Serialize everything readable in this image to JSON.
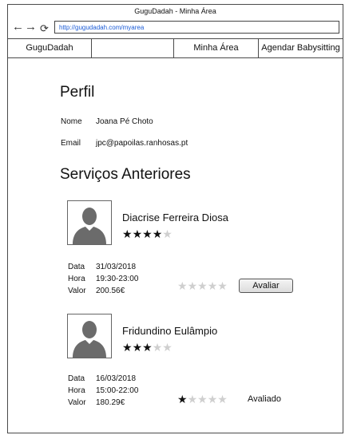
{
  "window": {
    "title": "GuguDadah - Minha Área"
  },
  "browser": {
    "url": "http://gugudadah.com/myarea"
  },
  "nav": {
    "items": [
      {
        "label": "GuguDadah"
      },
      {
        "label": ""
      },
      {
        "label": "Minha Área"
      },
      {
        "label": "Agendar Babysitting"
      }
    ]
  },
  "profile": {
    "heading": "Perfil",
    "name_label": "Nome",
    "name_value": "Joana Pé Choto",
    "email_label": "Email",
    "email_value": "jpc@papoilas.ranhosas.pt"
  },
  "services": {
    "heading": "Serviços Anteriores",
    "labels": {
      "date": "Data",
      "time": "Hora",
      "value": "Valor"
    },
    "items": [
      {
        "name": "Diacrise Ferreira Diosa",
        "babysitter_rating": 4,
        "date": "31/03/2018",
        "time": "19:30-23:00",
        "value": "200.56€",
        "user_rating": 0,
        "action_label": "Avaliar"
      },
      {
        "name": "Fridundino Eulâmpio",
        "babysitter_rating": 3,
        "date": "16/03/2018",
        "time": "15:00-22:00",
        "value": "180.29€",
        "user_rating": 1,
        "status_label": "Avaliado"
      }
    ]
  },
  "colors": {
    "star_on": "#111111",
    "star_off": "#cfcfcf",
    "link": "#1a5bd6",
    "avatar_fill": "#6b6b6b"
  },
  "icons": {
    "back": "arrow-left-icon",
    "forward": "arrow-right-icon",
    "reload": "reload-icon",
    "avatar": "person-silhouette-icon",
    "star": "star-icon"
  }
}
